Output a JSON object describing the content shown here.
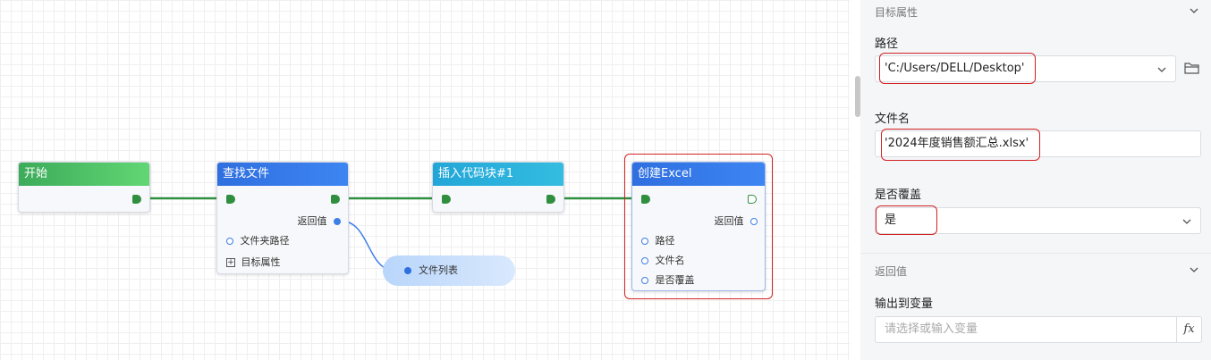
{
  "canvas": {
    "nodes": {
      "start": {
        "title": "开始"
      },
      "find_files": {
        "title": "查找文件",
        "return_label": "返回值",
        "param_folder": "文件夹路径",
        "target_attr": "目标属性",
        "expand_icon": "+"
      },
      "insert_code": {
        "title": "插入代码块#1"
      },
      "create_excel": {
        "title": "创建Excel",
        "return_label": "返回值",
        "param_path": "路径",
        "param_filename": "文件名",
        "param_overwrite": "是否覆盖"
      }
    },
    "variable_pill": {
      "label": "文件列表"
    },
    "colors": {
      "flow_wire": "#2f8f3f",
      "data_wire": "#3d7fe6",
      "highlight": "#d32222"
    }
  },
  "panel": {
    "target_section": {
      "title": "目标属性",
      "icon": "chevron-down-icon"
    },
    "path": {
      "label": "路径",
      "value": "'C:/Users/DELL/Desktop'",
      "browse_icon": "folder-icon"
    },
    "filename": {
      "label": "文件名",
      "value": "'2024年度销售额汇总.xlsx'"
    },
    "overwrite": {
      "label": "是否覆盖",
      "value": "是"
    },
    "return_section": {
      "title": "返回值",
      "icon": "chevron-down-icon"
    },
    "output_var": {
      "label": "输出到变量",
      "placeholder": "请选择或输入变量",
      "fx_label": "fx"
    }
  }
}
